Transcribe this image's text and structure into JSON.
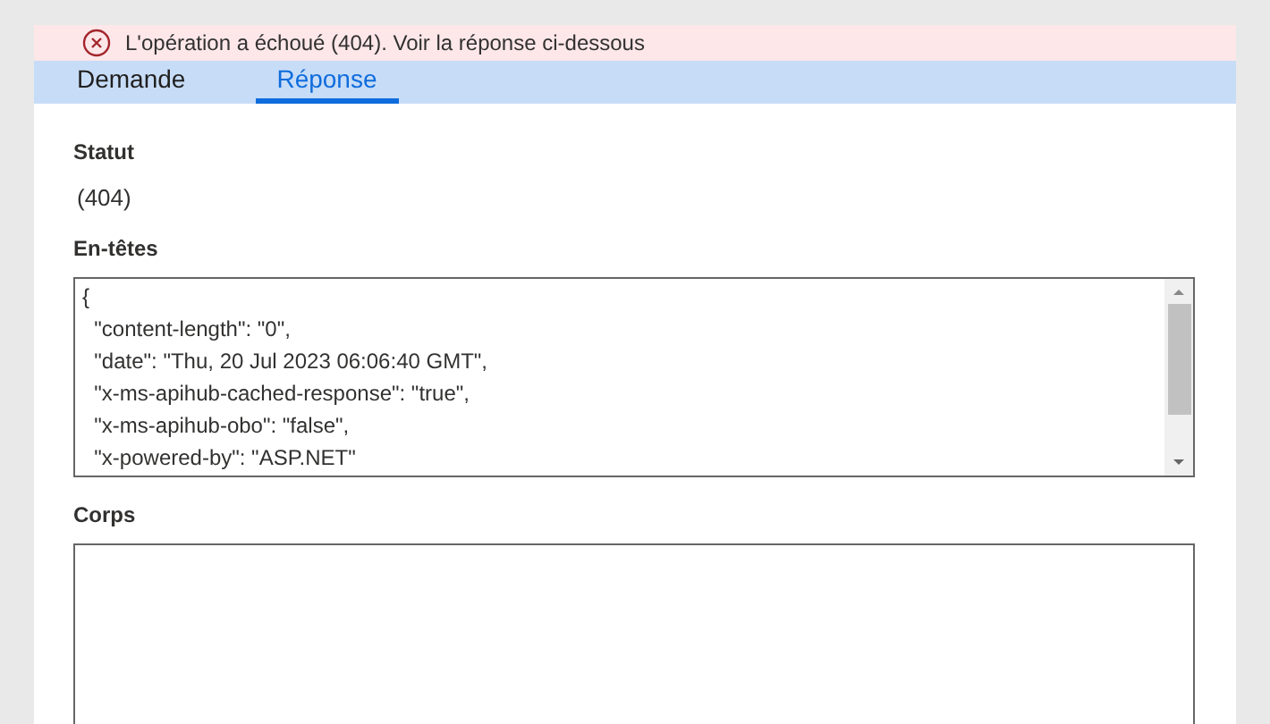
{
  "banner": {
    "kind": "error",
    "message": "L'opération a échoué (404). Voir la réponse ci-dessous"
  },
  "tabs": [
    {
      "label": "Demande",
      "selected": false
    },
    {
      "label": "Réponse",
      "selected": true
    }
  ],
  "status": {
    "label": "Statut",
    "value": "(404)"
  },
  "headers": {
    "label": "En-têtes",
    "lines": [
      "{",
      "  \"content-length\": \"0\",",
      "  \"date\": \"Thu, 20 Jul 2023 06:06:40 GMT\",",
      "  \"x-ms-apihub-cached-response\": \"true\",",
      "  \"x-ms-apihub-obo\": \"false\",",
      "  \"x-powered-by\": \"ASP.NET\""
    ]
  },
  "body": {
    "label": "Corps"
  }
}
